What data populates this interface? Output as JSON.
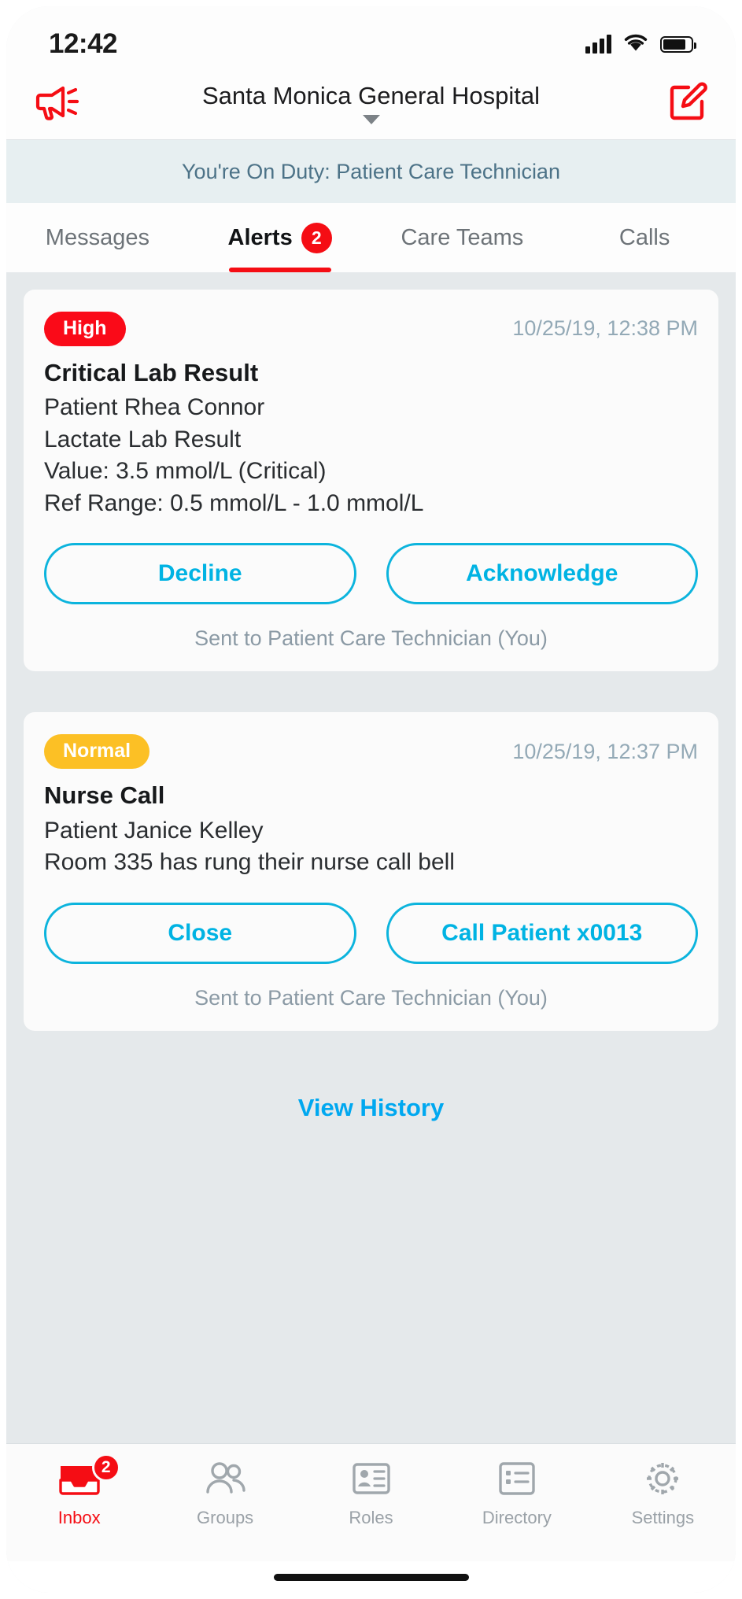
{
  "status_bar": {
    "time": "12:42",
    "signal_icon": "cellular-signal-icon",
    "wifi_icon": "wifi-icon",
    "battery_icon": "battery-icon"
  },
  "header": {
    "broadcast_icon": "megaphone-icon",
    "title": "Santa Monica General Hospital",
    "caret_icon": "chevron-down-icon",
    "compose_icon": "compose-icon"
  },
  "duty_banner": {
    "text": "You're On Duty: Patient Care Technician"
  },
  "tabs": [
    {
      "label": "Messages",
      "active": false,
      "badge": ""
    },
    {
      "label": "Alerts",
      "active": true,
      "badge": "2"
    },
    {
      "label": "Care Teams",
      "active": false,
      "badge": ""
    },
    {
      "label": "Calls",
      "active": false,
      "badge": ""
    }
  ],
  "alerts": [
    {
      "priority": "High",
      "priority_color": "#fa0a18",
      "timestamp": "10/25/19, 12:38 PM",
      "title": "Critical Lab Result",
      "lines": [
        "Patient Rhea Connor",
        "Lactate Lab Result",
        "Value: 3.5 mmol/L (Critical)",
        "Ref Range: 0.5 mmol/L - 1.0 mmol/L"
      ],
      "buttons": [
        {
          "label": "Decline"
        },
        {
          "label": "Acknowledge"
        }
      ],
      "footer": "Sent to Patient Care Technician (You)"
    },
    {
      "priority": "Normal",
      "priority_color": "#fcc025",
      "timestamp": "10/25/19, 12:37 PM",
      "title": "Nurse Call",
      "lines": [
        "Patient Janice Kelley",
        "Room 335 has rung their nurse call bell"
      ],
      "buttons": [
        {
          "label": "Close"
        },
        {
          "label": "Call Patient x0013"
        }
      ],
      "footer": "Sent to Patient Care Technician (You)"
    }
  ],
  "view_history": {
    "label": "View History"
  },
  "bottom_nav": [
    {
      "label": "Inbox",
      "icon": "inbox-icon",
      "badge": "2",
      "active": true
    },
    {
      "label": "Groups",
      "icon": "groups-icon",
      "badge": "",
      "active": false
    },
    {
      "label": "Roles",
      "icon": "roles-badge-icon",
      "badge": "",
      "active": false
    },
    {
      "label": "Directory",
      "icon": "directory-list-icon",
      "badge": "",
      "active": false
    },
    {
      "label": "Settings",
      "icon": "gear-icon",
      "badge": "",
      "active": false
    }
  ],
  "colors": {
    "accent_red": "#f50d14",
    "accent_cyan": "#00b3e3",
    "link_blue": "#00a8f0",
    "duty_bg": "#e7eff1",
    "content_bg": "#e5e9eb"
  }
}
